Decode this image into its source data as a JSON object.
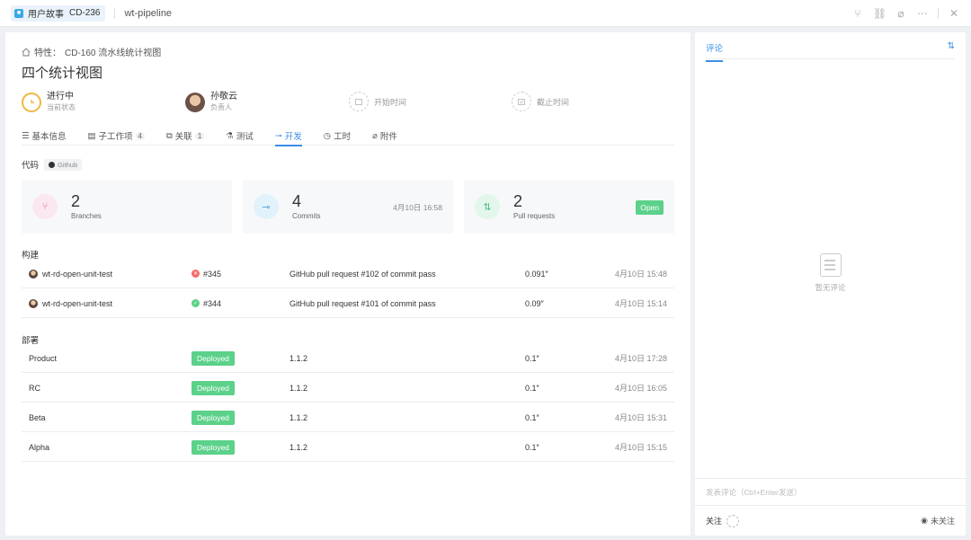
{
  "header": {
    "type_label": "用户故事",
    "item_code": "CD-236",
    "project": "wt-pipeline",
    "actions": [
      "branch-icon",
      "link-icon",
      "attachment-icon",
      "more-icon",
      "close-icon"
    ]
  },
  "breadcrumb": {
    "prefix": "特性：",
    "text": "CD-160 流水线统计视图"
  },
  "title": "四个统计视图",
  "status": {
    "state": "进行中",
    "state_label": "当前状态",
    "assignee": "孙敬云",
    "assignee_label": "负责人",
    "start_time": "开始时间",
    "deadline": "截止时间"
  },
  "tabs": [
    {
      "label": "基本信息",
      "count": ""
    },
    {
      "label": "子工作项",
      "count": "4"
    },
    {
      "label": "关联",
      "count": "1"
    },
    {
      "label": "测试",
      "count": ""
    },
    {
      "label": "开发",
      "count": ""
    },
    {
      "label": "工时",
      "count": ""
    },
    {
      "label": "附件",
      "count": ""
    }
  ],
  "active_tab": "开发",
  "code": {
    "label": "代码",
    "source": "Github"
  },
  "stats": {
    "branches": {
      "value": "2",
      "label": "Branches"
    },
    "commits": {
      "value": "4",
      "label": "Commits",
      "time": "4月10日 16:58"
    },
    "pull_requests": {
      "value": "2",
      "label": "Pull requests",
      "status": "Open"
    }
  },
  "builds": {
    "label": "构建",
    "rows": [
      {
        "name": "wt-rd-open-unit-test",
        "status": "fail",
        "id": "#345",
        "message": "GitHub pull request #102 of commit pass",
        "duration": "0.091″",
        "time": "4月10日 15:48"
      },
      {
        "name": "wt-rd-open-unit-test",
        "status": "pass",
        "id": "#344",
        "message": "GitHub pull request #101 of commit pass",
        "duration": "0.09″",
        "time": "4月10日 15:14"
      }
    ]
  },
  "deploys": {
    "label": "部署",
    "rows": [
      {
        "env": "Product",
        "status": "Deployed",
        "version": "1.1.2",
        "duration": "0.1″",
        "time": "4月10日 17:28"
      },
      {
        "env": "RC",
        "status": "Deployed",
        "version": "1.1.2",
        "duration": "0.1″",
        "time": "4月10日 16:05"
      },
      {
        "env": "Beta",
        "status": "Deployed",
        "version": "1.1.2",
        "duration": "0.1″",
        "time": "4月10日 15:31"
      },
      {
        "env": "Alpha",
        "status": "Deployed",
        "version": "1.1.2",
        "duration": "0.1″",
        "time": "4月10日 15:15"
      }
    ]
  },
  "comments": {
    "tab": "评论",
    "empty": "暂无评论",
    "input_placeholder": "发表评论（Ctrl+Enter发送）",
    "follow": "关注",
    "unfollow": "未关注"
  },
  "colors": {
    "accent": "#3a8ee6",
    "success": "#5cd18a",
    "fail": "#f26b6b",
    "state_ring": "#f0b73f"
  }
}
